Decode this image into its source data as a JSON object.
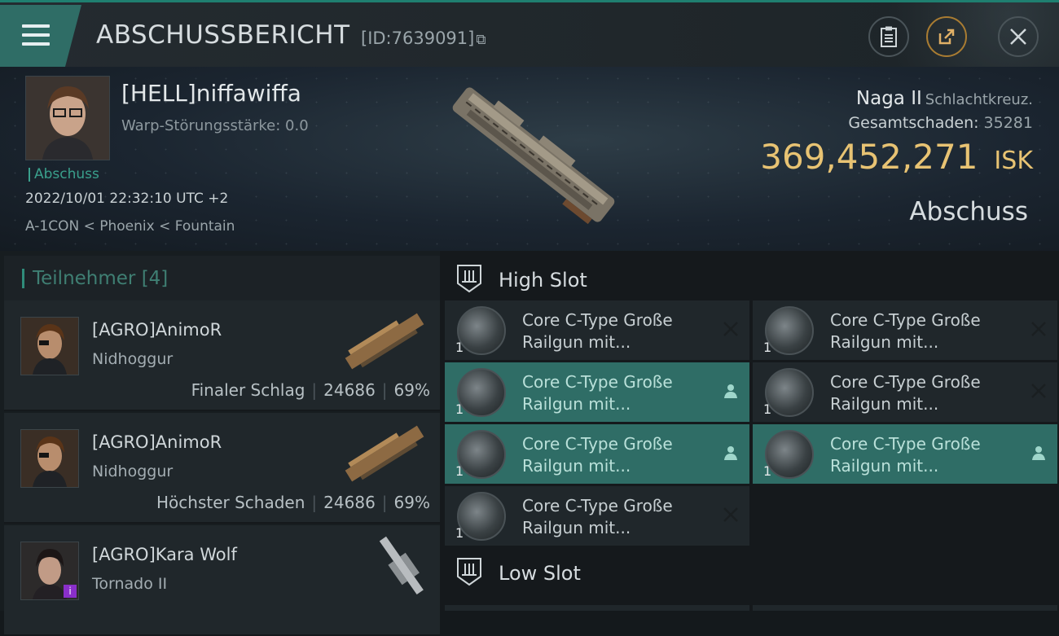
{
  "header": {
    "title": "ABSCHUSSBERICHT",
    "id_text": "[ID:7639091]"
  },
  "victim": {
    "name": "[HELL]niffawiffa",
    "warp_line": "Warp-Störungsstärke: 0.0",
    "kill_tag": "Abschuss",
    "datetime": "2022/10/01 22:32:10 UTC +2",
    "location": "A-1CON < Phoenix < Fountain",
    "ship": "Naga II",
    "ship_class": "Schlachtkreuz.",
    "damage_label": "Gesamtschaden:",
    "damage_value": "35281",
    "isk_value": "369,452,271",
    "isk_unit": "ISK",
    "kill_type": "Abschuss"
  },
  "participants": {
    "title": "Teilnehmer [4]",
    "rows": [
      {
        "name": "[AGRO]AnimoR",
        "ship": "Nidhoggur",
        "role": "Finaler Schlag",
        "damage": "24686",
        "percent": "69%"
      },
      {
        "name": "[AGRO]AnimoR",
        "ship": "Nidhoggur",
        "role": "Höchster Schaden",
        "damage": "24686",
        "percent": "69%"
      },
      {
        "name": "[AGRO]Kara Wolf",
        "ship": "Tornado II",
        "badge": "i"
      }
    ]
  },
  "slots": {
    "high_label": "High Slot",
    "low_label": "Low Slot",
    "modules": [
      {
        "line1": "Core C-Type Große",
        "line2": "Railgun mit...",
        "qty": "1",
        "state": "destroyed"
      },
      {
        "line1": "Core C-Type Große",
        "line2": "Railgun mit...",
        "qty": "1",
        "state": "destroyed"
      },
      {
        "line1": "Core C-Type Große",
        "line2": "Railgun mit...",
        "qty": "1",
        "state": "dropped"
      },
      {
        "line1": "Core C-Type Große",
        "line2": "Railgun mit...",
        "qty": "1",
        "state": "destroyed"
      },
      {
        "line1": "Core C-Type Große",
        "line2": "Railgun mit...",
        "qty": "1",
        "state": "dropped"
      },
      {
        "line1": "Core C-Type Große",
        "line2": "Railgun mit...",
        "qty": "1",
        "state": "dropped"
      },
      {
        "line1": "Core C-Type Große",
        "line2": "Railgun mit...",
        "qty": "1",
        "state": "destroyed"
      }
    ]
  },
  "colors": {
    "accent": "#2f6d66",
    "isk": "#e8c373",
    "teal_text": "#3aa08c"
  }
}
